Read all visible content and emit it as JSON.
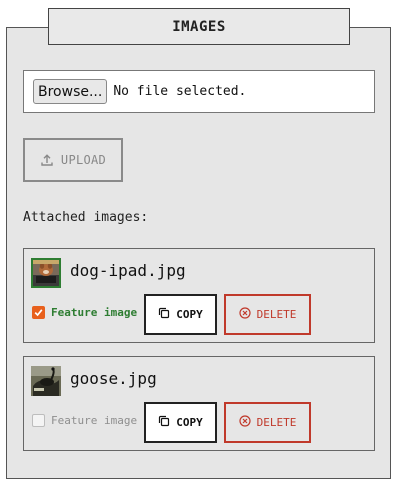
{
  "panel": {
    "title": "IMAGES"
  },
  "file_input": {
    "browse_label": "Browse...",
    "status": "No file selected."
  },
  "upload": {
    "label": "UPLOAD",
    "icon": "upload-icon",
    "enabled": false
  },
  "attached": {
    "label": "Attached images:",
    "images": [
      {
        "filename": "dog-ipad.jpg",
        "featured": true,
        "feature_label": "Feature image",
        "copy_label": "COPY",
        "delete_label": "DELETE"
      },
      {
        "filename": "goose.jpg",
        "featured": false,
        "feature_label": "Feature image",
        "copy_label": "COPY",
        "delete_label": "DELETE"
      }
    ]
  },
  "colors": {
    "featured_green": "#2e7d32",
    "checkbox_orange": "#e8601c",
    "delete_red": "#c0392b",
    "panel_bg": "#e6e6e6"
  }
}
